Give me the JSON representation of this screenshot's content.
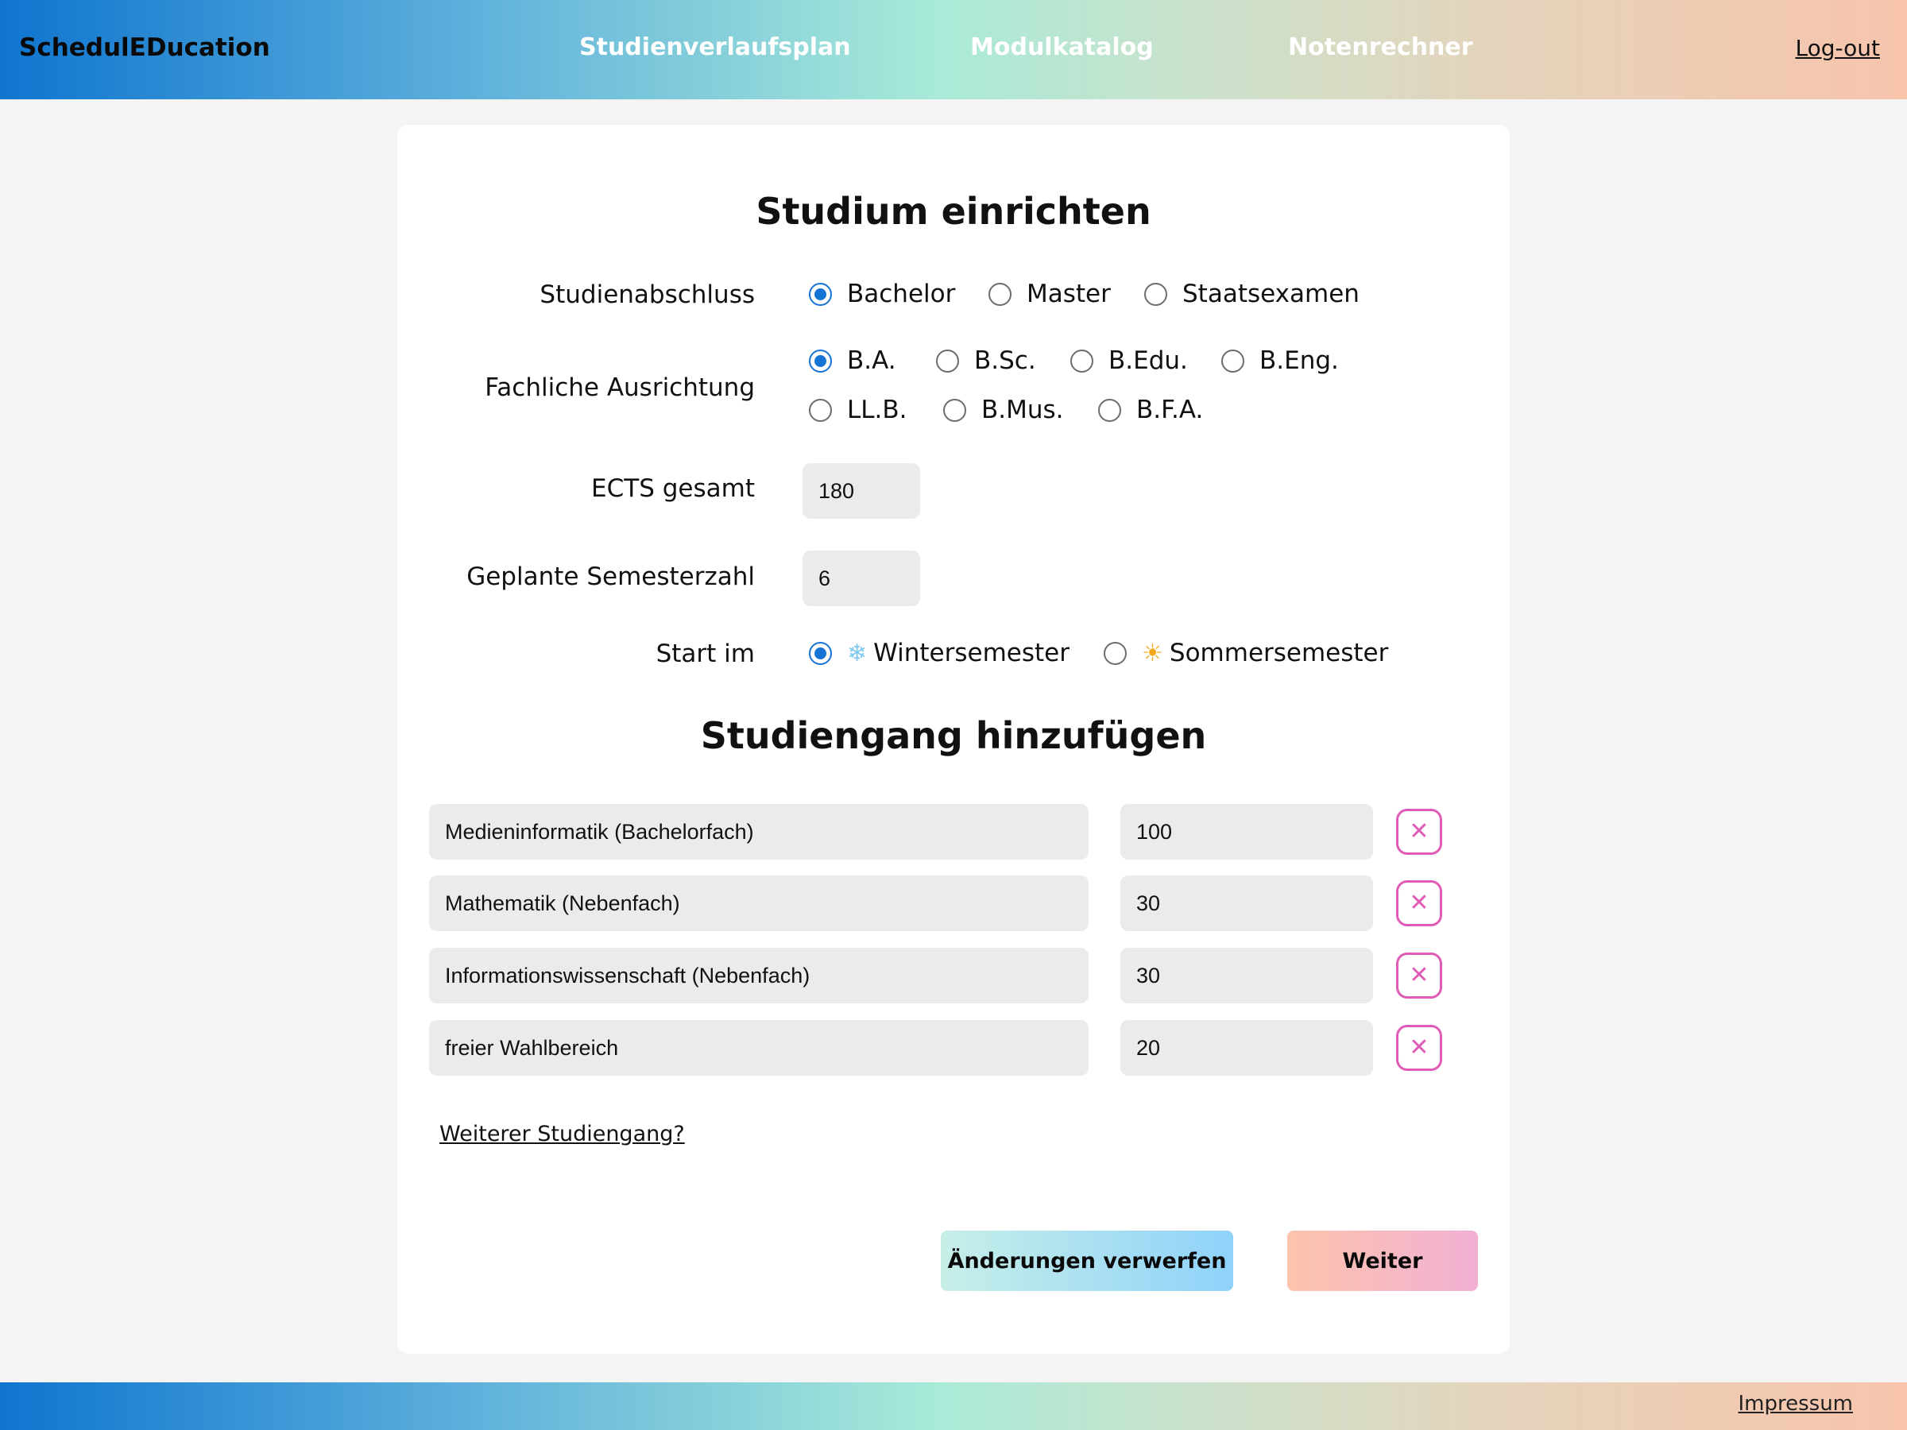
{
  "header": {
    "brand": "SchedulEDucation",
    "nav": [
      "Studienverlaufsplan",
      "Modulkatalog",
      "Notenrechner"
    ],
    "logout": "Log-out"
  },
  "form": {
    "title": "Studium einrichten",
    "degree": {
      "label": "Studienabschluss",
      "options": [
        "Bachelor",
        "Master",
        "Staatsexamen"
      ],
      "selected": "Bachelor"
    },
    "orientation": {
      "label": "Fachliche Ausrichtung",
      "options": [
        "B.A.",
        "B.Sc.",
        "B.Edu.",
        "B.Eng.",
        "LL.B.",
        "B.Mus.",
        "B.F.A."
      ],
      "selected": "B.A."
    },
    "ects": {
      "label": "ECTS gesamt",
      "value": "180"
    },
    "semesters": {
      "label": "Geplante Semesterzahl",
      "value": "6"
    },
    "start": {
      "label": "Start im",
      "options": [
        "Wintersemester",
        "Sommersemester"
      ],
      "selected": "Wintersemester"
    }
  },
  "programs": {
    "title": "Studiengang hinzufügen",
    "rows": [
      {
        "name": "Medieninformatik (Bachelorfach)",
        "ects": "100"
      },
      {
        "name": "Mathematik (Nebenfach)",
        "ects": "30"
      },
      {
        "name": "Informationswissenschaft (Nebenfach)",
        "ects": "30"
      },
      {
        "name": "freier Wahlbereich",
        "ects": "20"
      }
    ],
    "remove_icon": "close-icon",
    "add_link": "Weiterer Studiengang?"
  },
  "actions": {
    "discard": "Änderungen verwerfen",
    "next": "Weiter"
  },
  "footer": {
    "impressum": "Impressum"
  },
  "colors": {
    "accent_blue": "#1673d6",
    "remove_pink": "#e05bb5"
  }
}
